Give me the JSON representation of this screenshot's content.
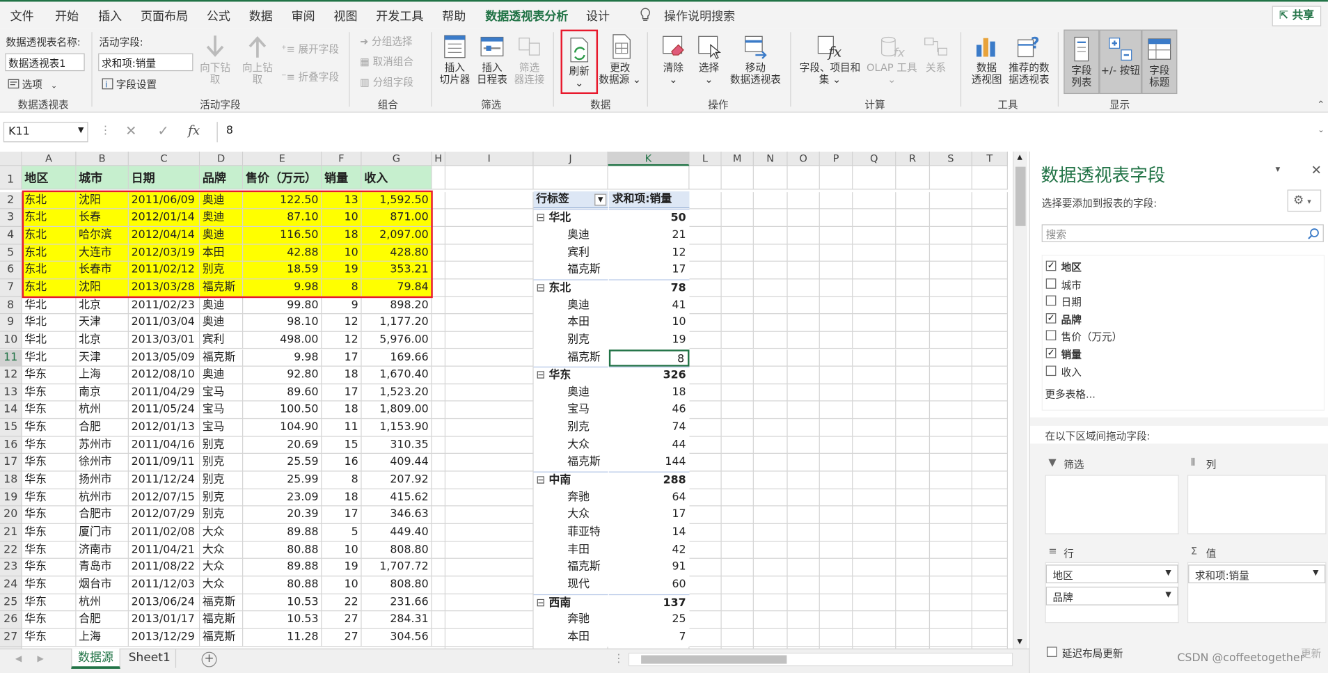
{
  "menu": {
    "items": [
      "文件",
      "开始",
      "插入",
      "页面布局",
      "公式",
      "数据",
      "审阅",
      "视图",
      "开发工具",
      "帮助",
      "数据透视表分析",
      "设计"
    ],
    "active_index": 10,
    "tell_me": "操作说明搜索",
    "share": "共享"
  },
  "ribbon": {
    "pivot_name_label": "数据透视表名称:",
    "pivot_name_value": "数据透视表1",
    "options_label": "选项",
    "active_field_label": "活动字段:",
    "active_field_value": "求和项:销量",
    "field_settings_label": "字段设置",
    "drill_down": [
      "向下钻",
      "取"
    ],
    "drill_up": [
      "向上钻",
      "取"
    ],
    "expand_field": "展开字段",
    "collapse_field": "折叠字段",
    "group_selection": "分组选择",
    "ungroup": "取消组合",
    "group_field": "分组字段",
    "insert_slicer": [
      "插入",
      "切片器"
    ],
    "insert_timeline": [
      "插入",
      "日程表"
    ],
    "filter_connections": [
      "筛选",
      "器连接"
    ],
    "refresh": [
      "刷新",
      "⌄"
    ],
    "change_source": [
      "更改",
      "数据源 ⌄"
    ],
    "clear": [
      "清除",
      "⌄"
    ],
    "select": [
      "选择",
      "⌄"
    ],
    "move_pivot": [
      "移动",
      "数据透视表"
    ],
    "fields_items": [
      "字段、项目和",
      "集 ⌄"
    ],
    "olap_tools": [
      "OLAP 工具",
      "⌄"
    ],
    "relationships": [
      "关系",
      ""
    ],
    "pivot_chart": [
      "数据",
      "透视图"
    ],
    "recommended": [
      "推荐的数",
      "据透视表"
    ],
    "field_list": [
      "字段",
      "列表"
    ],
    "plus_minus": [
      "+/- 按钮",
      ""
    ],
    "field_headers": [
      "字段",
      "标题"
    ],
    "groups": [
      "数据透视表",
      "活动字段",
      "组合",
      "筛选",
      "数据",
      "操作",
      "计算",
      "工具",
      "显示"
    ]
  },
  "formula": {
    "name_box": "K11",
    "value": "8"
  },
  "columns": [
    "A",
    "B",
    "C",
    "D",
    "E",
    "F",
    "G",
    "H",
    "I",
    "J",
    "K",
    "L",
    "M",
    "N",
    "O",
    "P",
    "Q",
    "R",
    "S",
    "T"
  ],
  "headers": [
    "地区",
    "城市",
    "日期",
    "品牌",
    "售价（万元）",
    "销量",
    "收入"
  ],
  "rows": [
    [
      "东北",
      "沈阳",
      "2011/06/09",
      "奥迪",
      "122.50",
      "13",
      "1,592.50"
    ],
    [
      "东北",
      "长春",
      "2012/01/14",
      "奥迪",
      "87.10",
      "10",
      "871.00"
    ],
    [
      "东北",
      "哈尔滨",
      "2012/04/14",
      "奥迪",
      "116.50",
      "18",
      "2,097.00"
    ],
    [
      "东北",
      "大连市",
      "2012/03/19",
      "本田",
      "42.88",
      "10",
      "428.80"
    ],
    [
      "东北",
      "长春市",
      "2011/02/12",
      "别克",
      "18.59",
      "19",
      "353.21"
    ],
    [
      "东北",
      "沈阳",
      "2013/03/28",
      "福克斯",
      "9.98",
      "8",
      "79.84"
    ],
    [
      "华北",
      "北京",
      "2011/02/23",
      "奥迪",
      "99.80",
      "9",
      "898.20"
    ],
    [
      "华北",
      "天津",
      "2011/03/04",
      "奥迪",
      "98.10",
      "12",
      "1,177.20"
    ],
    [
      "华北",
      "北京",
      "2013/03/01",
      "宾利",
      "498.00",
      "12",
      "5,976.00"
    ],
    [
      "华北",
      "天津",
      "2013/05/09",
      "福克斯",
      "9.98",
      "17",
      "169.66"
    ],
    [
      "华东",
      "上海",
      "2012/08/10",
      "奥迪",
      "92.80",
      "18",
      "1,670.40"
    ],
    [
      "华东",
      "南京",
      "2011/04/29",
      "宝马",
      "89.60",
      "17",
      "1,523.20"
    ],
    [
      "华东",
      "杭州",
      "2011/05/24",
      "宝马",
      "100.50",
      "18",
      "1,809.00"
    ],
    [
      "华东",
      "合肥",
      "2012/01/13",
      "宝马",
      "104.90",
      "11",
      "1,153.90"
    ],
    [
      "华东",
      "苏州市",
      "2011/04/16",
      "别克",
      "20.69",
      "15",
      "310.35"
    ],
    [
      "华东",
      "徐州市",
      "2011/09/11",
      "别克",
      "25.59",
      "16",
      "409.44"
    ],
    [
      "华东",
      "扬州市",
      "2011/12/24",
      "别克",
      "25.99",
      "8",
      "207.92"
    ],
    [
      "华东",
      "杭州市",
      "2012/07/15",
      "别克",
      "23.09",
      "18",
      "415.62"
    ],
    [
      "华东",
      "合肥市",
      "2012/07/29",
      "别克",
      "20.39",
      "17",
      "346.63"
    ],
    [
      "华东",
      "厦门市",
      "2011/02/08",
      "大众",
      "89.88",
      "5",
      "449.40"
    ],
    [
      "华东",
      "济南市",
      "2011/04/21",
      "大众",
      "80.88",
      "10",
      "808.80"
    ],
    [
      "华东",
      "青岛市",
      "2011/08/22",
      "大众",
      "89.88",
      "19",
      "1,707.72"
    ],
    [
      "华东",
      "烟台市",
      "2011/12/03",
      "大众",
      "80.88",
      "10",
      "808.80"
    ],
    [
      "华东",
      "杭州",
      "2013/06/24",
      "福克斯",
      "10.53",
      "22",
      "231.66"
    ],
    [
      "华东",
      "合肥",
      "2013/01/17",
      "福克斯",
      "10.53",
      "27",
      "284.31"
    ],
    [
      "华东",
      "上海",
      "2013/12/29",
      "福克斯",
      "11.28",
      "27",
      "304.56"
    ]
  ],
  "pivot": {
    "row_label": "行标签",
    "value_label": "求和项:销量",
    "rows": [
      {
        "label": "华北",
        "value": "50",
        "group": true
      },
      {
        "label": "奥迪",
        "value": "21",
        "group": false
      },
      {
        "label": "宾利",
        "value": "12",
        "group": false
      },
      {
        "label": "福克斯",
        "value": "17",
        "group": false
      },
      {
        "label": "东北",
        "value": "78",
        "group": true
      },
      {
        "label": "奥迪",
        "value": "41",
        "group": false
      },
      {
        "label": "本田",
        "value": "10",
        "group": false
      },
      {
        "label": "别克",
        "value": "19",
        "group": false
      },
      {
        "label": "福克斯",
        "value": "8",
        "group": false
      },
      {
        "label": "华东",
        "value": "326",
        "group": true
      },
      {
        "label": "奥迪",
        "value": "18",
        "group": false
      },
      {
        "label": "宝马",
        "value": "46",
        "group": false
      },
      {
        "label": "别克",
        "value": "74",
        "group": false
      },
      {
        "label": "大众",
        "value": "44",
        "group": false
      },
      {
        "label": "福克斯",
        "value": "144",
        "group": false
      },
      {
        "label": "中南",
        "value": "288",
        "group": true
      },
      {
        "label": "奔驰",
        "value": "64",
        "group": false
      },
      {
        "label": "大众",
        "value": "17",
        "group": false
      },
      {
        "label": "菲亚特",
        "value": "14",
        "group": false
      },
      {
        "label": "丰田",
        "value": "42",
        "group": false
      },
      {
        "label": "福克斯",
        "value": "91",
        "group": false
      },
      {
        "label": "现代",
        "value": "60",
        "group": false
      },
      {
        "label": "西南",
        "value": "137",
        "group": true
      },
      {
        "label": "奔驰",
        "value": "25",
        "group": false
      },
      {
        "label": "本田",
        "value": "7",
        "group": false
      }
    ]
  },
  "sheet_tabs": [
    "数据源",
    "Sheet1"
  ],
  "active_sheet": 0,
  "pane": {
    "title": "数据透视表字段",
    "subtitle": "选择要添加到报表的字段:",
    "search_placeholder": "搜索",
    "fields": [
      {
        "name": "地区",
        "checked": true
      },
      {
        "name": "城市",
        "checked": false
      },
      {
        "name": "日期",
        "checked": false
      },
      {
        "name": "品牌",
        "checked": true
      },
      {
        "name": "售价（万元）",
        "checked": false
      },
      {
        "name": "销量",
        "checked": true
      },
      {
        "name": "收入",
        "checked": false
      }
    ],
    "more_tables": "更多表格...",
    "drag_hint": "在以下区域间拖动字段:",
    "filters_label": "筛选",
    "columns_label": "列",
    "rows_label": "行",
    "values_label": "值",
    "row_fields": [
      "地区",
      "品牌"
    ],
    "value_fields": [
      "求和项:销量"
    ],
    "defer_label": "延迟布局更新",
    "update_button": "更新"
  },
  "watermark": "CSDN @coffeetogether",
  "colors": {
    "accent": "#217346",
    "highlight": "#ffff00",
    "header_fill": "#c6efce",
    "border_red": "#e8192c"
  }
}
